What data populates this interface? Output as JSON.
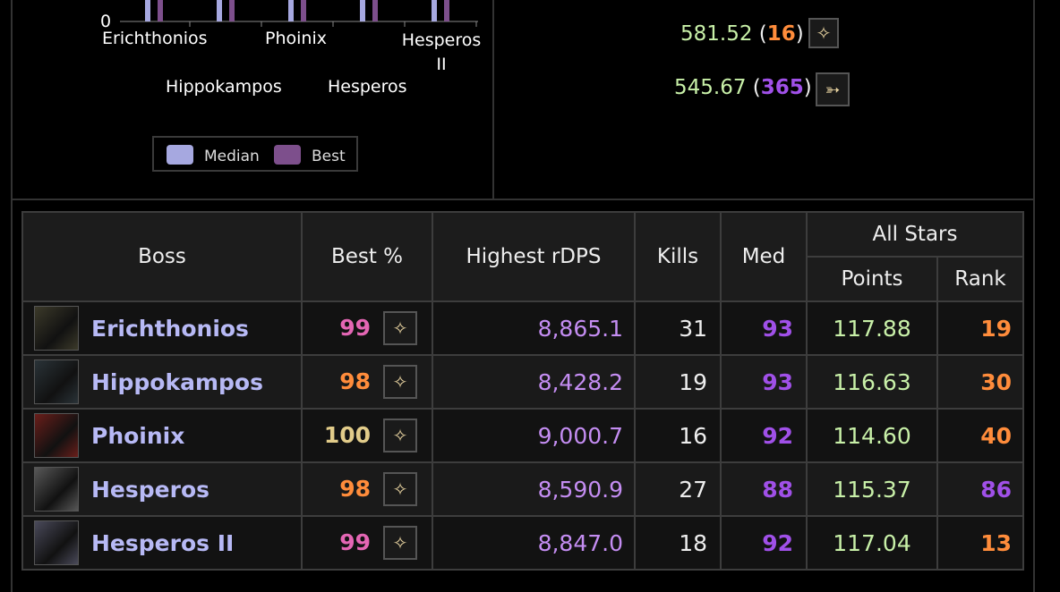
{
  "chart": {
    "axis_zero": "0",
    "labels_top": [
      "Erichthonios",
      "Phoinix",
      "Hesperos II"
    ],
    "labels_bottom": [
      "Hippokampos",
      "Hesperos"
    ],
    "legend": [
      {
        "label": "Median",
        "color": "#a6a8e0"
      },
      {
        "label": "Best",
        "color": "#7d4f8c"
      }
    ]
  },
  "chart_data": {
    "type": "bar",
    "categories": [
      "Erichthonios",
      "Hippokampos",
      "Phoinix",
      "Hesperos",
      "Hesperos II"
    ],
    "series": [
      {
        "name": "Median",
        "values": [
          93,
          93,
          92,
          88,
          92
        ]
      },
      {
        "name": "Best",
        "values": [
          99,
          98,
          100,
          98,
          99
        ]
      }
    ],
    "xlabel": "",
    "ylabel": ""
  },
  "parses": [
    {
      "score": "581.52",
      "open": "(",
      "rank": "16",
      "close": ")",
      "rank_color": "#ff8c3b",
      "icon": "job-icon-1"
    },
    {
      "score": "545.67",
      "open": "(",
      "rank": "365",
      "close": ")",
      "rank_color": "#a050e8",
      "icon": "job-icon-2"
    }
  ],
  "table": {
    "headers": {
      "boss": "Boss",
      "best": "Best %",
      "dps": "Highest rDPS",
      "kills": "Kills",
      "med": "Med",
      "allstars": "All Stars",
      "points": "Points",
      "rank": "Rank"
    },
    "rows": [
      {
        "boss": "Erichthonios",
        "best": "99",
        "best_color": "#e466b4",
        "dps": "8,865.1",
        "kills": "31",
        "med": "93",
        "med_color": "#a050e8",
        "points": "117.88",
        "rank": "19",
        "rank_color": "#ff8c3b",
        "portrait": "#3c3a2a"
      },
      {
        "boss": "Hippokampos",
        "best": "98",
        "best_color": "#ff8c3b",
        "dps": "8,428.2",
        "kills": "19",
        "med": "93",
        "med_color": "#a050e8",
        "points": "116.63",
        "rank": "30",
        "rank_color": "#ff8c3b",
        "portrait": "#2a3338"
      },
      {
        "boss": "Phoinix",
        "best": "100",
        "best_color": "#e2cc8a",
        "dps": "9,000.7",
        "kills": "16",
        "med": "92",
        "med_color": "#a050e8",
        "points": "114.60",
        "rank": "40",
        "rank_color": "#ff8c3b",
        "portrait": "#6a1e1a"
      },
      {
        "boss": "Hesperos",
        "best": "98",
        "best_color": "#ff8c3b",
        "dps": "8,590.9",
        "kills": "27",
        "med": "88",
        "med_color": "#a050e8",
        "points": "115.37",
        "rank": "86",
        "rank_color": "#a050e8",
        "portrait": "#585858"
      },
      {
        "boss": "Hesperos II",
        "best": "99",
        "best_color": "#e466b4",
        "dps": "8,847.0",
        "kills": "18",
        "med": "92",
        "med_color": "#a050e8",
        "points": "117.04",
        "rank": "13",
        "rank_color": "#ff8c3b",
        "portrait": "#4a4a5a"
      }
    ]
  }
}
